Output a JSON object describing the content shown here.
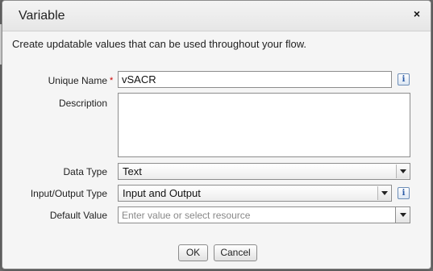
{
  "dialog": {
    "title": "Variable",
    "close_glyph": "×",
    "intro": "Create updatable values that can be used throughout your flow."
  },
  "fields": {
    "unique_name": {
      "label": "Unique Name",
      "required_mark": "*",
      "value": "vSACR",
      "info_glyph": "i"
    },
    "description": {
      "label": "Description",
      "value": ""
    },
    "data_type": {
      "label": "Data Type",
      "value": "Text"
    },
    "io_type": {
      "label": "Input/Output Type",
      "value": "Input and Output",
      "info_glyph": "i"
    },
    "default_value": {
      "label": "Default Value",
      "placeholder": "Enter value or select resource"
    }
  },
  "buttons": {
    "ok": "OK",
    "cancel": "Cancel"
  },
  "icons": [
    "close-icon",
    "info-icon",
    "dropdown-arrow-icon"
  ]
}
